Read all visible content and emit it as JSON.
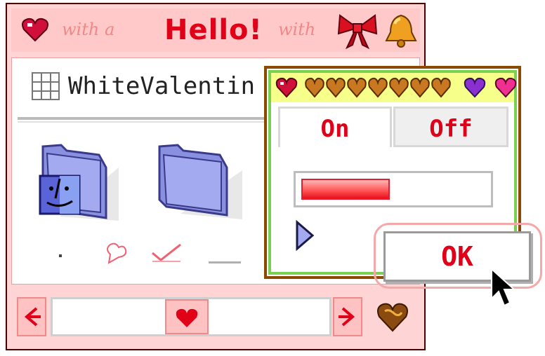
{
  "window": {
    "title": "Hello!",
    "script_left": "with a",
    "script_right": "with"
  },
  "pathbar": {
    "folder_name": "WhiteValentin"
  },
  "icons": {
    "title_left": "heart-icon",
    "title_bow": "bow-icon",
    "title_bell": "bell-icon",
    "folder_finder": "finder-folder-icon",
    "folder_plain": "folder-icon",
    "scroll_thumb": "heart-icon",
    "corner": "chocolate-heart-icon",
    "cursor": "arrow-cursor-icon"
  },
  "dialog": {
    "tabs": [
      {
        "label": "On",
        "selected": true
      },
      {
        "label": "Off",
        "selected": false
      }
    ],
    "progress": 0.48
  },
  "ok_button": {
    "label": "OK"
  },
  "colors": {
    "accent_red": "#e00018",
    "window_pink": "#ffd4d4",
    "title_pink": "#ffc9c9",
    "dialog_title_yellow": "#f5ff8a",
    "dialog_border_brown": "#8b4a00",
    "dialog_border_green": "#7ad050"
  }
}
